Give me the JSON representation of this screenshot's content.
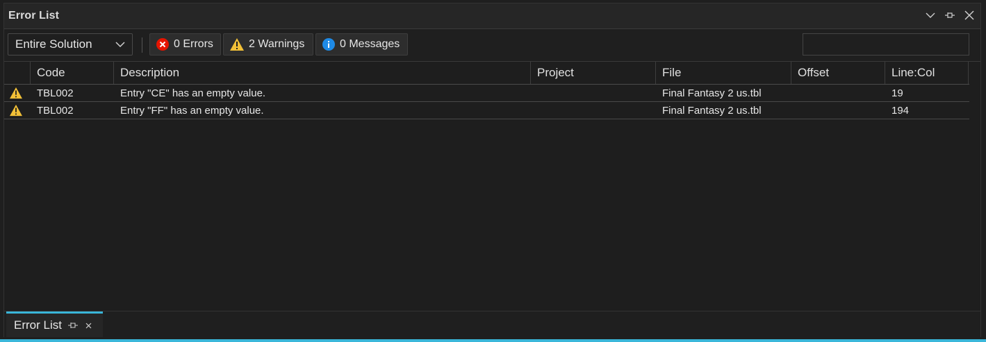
{
  "window": {
    "title": "Error List"
  },
  "toolbar": {
    "scope": "Entire Solution",
    "errors_label": "0 Errors",
    "warnings_label": "2 Warnings",
    "messages_label": "0 Messages",
    "search_value": ""
  },
  "columns": [
    "Code",
    "Description",
    "Project",
    "File",
    "Offset",
    "Line:Col"
  ],
  "rows": [
    {
      "severity": "warning",
      "code": "TBL002",
      "description": "Entry \"CE\" has an empty value.",
      "project": "",
      "file": "Final Fantasy 2 us.tbl",
      "offset": "",
      "line_col": "19"
    },
    {
      "severity": "warning",
      "code": "TBL002",
      "description": "Entry \"FF\" has an empty value.",
      "project": "",
      "file": "Final Fantasy 2 us.tbl",
      "offset": "",
      "line_col": "194"
    }
  ],
  "bottom_tab": {
    "label": "Error List"
  },
  "colors": {
    "accent": "#3ab6d9",
    "error": "#e51400",
    "warning": "#f2c037",
    "info": "#1e8ae6"
  }
}
